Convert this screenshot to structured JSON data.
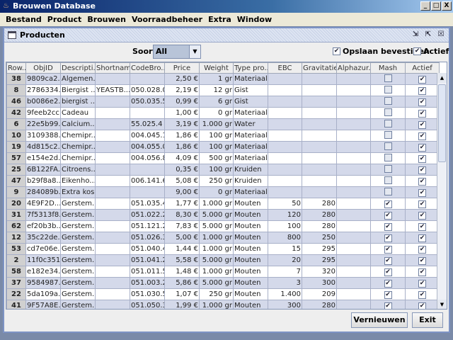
{
  "window": {
    "title": "Brouwen Database",
    "controls": [
      "_",
      "□",
      "X"
    ]
  },
  "menu": [
    "Bestand",
    "Product",
    "Brouwen",
    "Voorraadbeheer",
    "Extra",
    "Window"
  ],
  "frame": {
    "title": "Producten",
    "controls": [
      "⇲",
      "⇱",
      "☒"
    ]
  },
  "toolbar": {
    "soort_label": "Soort",
    "soort_value": "All",
    "opslaan_label": "Opslaan bevestigen",
    "opslaan_checked": true,
    "actief_label": "Actief",
    "actief_checked": true
  },
  "table": {
    "columns": [
      "Row...",
      "ObjID",
      "Descripti...",
      "Shortname",
      "CodeBro...",
      "Price",
      "Weight",
      "Type pro...",
      "EBC",
      "Gravitatie...",
      "Alphazur...",
      "Mash",
      "Actief"
    ],
    "rows": [
      [
        "38",
        "9809ca2...",
        "Algemen...",
        "",
        "",
        "2,50 €",
        "1 gr",
        "Materiaal",
        "",
        "",
        "",
        false,
        true
      ],
      [
        "8",
        "2786334...",
        "Biergist ...",
        "YEASTB...",
        "050.028.0",
        "2,19 €",
        "12 gr",
        "Gist",
        "",
        "",
        "",
        false,
        true
      ],
      [
        "46",
        "b0086e2...",
        "biergist ...",
        "",
        "050.035.5",
        "0,99 €",
        "6 gr",
        "Gist",
        "",
        "",
        "",
        false,
        true
      ],
      [
        "42",
        "9feeb2cc...",
        "Cadeau",
        "",
        "",
        "1,00 €",
        "0 gr",
        "Materiaal",
        "",
        "",
        "",
        false,
        true
      ],
      [
        "6",
        "22e5b99...",
        "Calcium...",
        "",
        "55.025.4",
        "3,19 €",
        "1.000 gr",
        "Water",
        "",
        "",
        "",
        false,
        true
      ],
      [
        "10",
        "3109388...",
        "Chemipr...",
        "",
        "004.045.1",
        "1,86 €",
        "100 gr",
        "Materiaal",
        "",
        "",
        "",
        false,
        true
      ],
      [
        "19",
        "4d815c2...",
        "Chemipr...",
        "",
        "004.055.0",
        "1,86 €",
        "100 gr",
        "Materiaal",
        "",
        "",
        "",
        false,
        true
      ],
      [
        "57",
        "e154e2d...",
        "Chemipr...",
        "",
        "004.056.8",
        "4,09 €",
        "500 gr",
        "Materiaal",
        "",
        "",
        "",
        false,
        true
      ],
      [
        "25",
        "6B122FA...",
        "Citroens...",
        "",
        "",
        "0,35 €",
        "100 gr",
        "Kruiden",
        "",
        "",
        "",
        false,
        true
      ],
      [
        "47",
        "b29f8a8...",
        "Eikenho...",
        "",
        "006.141.6",
        "5,08 €",
        "250 gr",
        "Kruiden",
        "",
        "",
        "",
        false,
        true
      ],
      [
        "9",
        "284089b...",
        "Extra kos...",
        "",
        "",
        "9,00 €",
        "0 gr",
        "Materiaal",
        "",
        "",
        "",
        false,
        true
      ],
      [
        "20",
        "4E9F2D...",
        "Gerstem...",
        "",
        "051.035.4",
        "1,77 €",
        "1.000 gr",
        "Mouten",
        "50",
        "280",
        "",
        true,
        true
      ],
      [
        "31",
        "7f5313f8...",
        "Gerstem...",
        "",
        "051.022.2",
        "8,30 €",
        "5.000 gr",
        "Mouten",
        "120",
        "280",
        "",
        true,
        true
      ],
      [
        "62",
        "ef20b3b...",
        "Gerstem...",
        "",
        "051.121.2",
        "7,83 €",
        "5.000 gr",
        "Mouten",
        "100",
        "280",
        "",
        true,
        true
      ],
      [
        "12",
        "35c22de...",
        "Gerstem...",
        "",
        "051.026.3",
        "5,00 €",
        "1.000 gr",
        "Mouten",
        "800",
        "250",
        "",
        true,
        true
      ],
      [
        "53",
        "cd7e06e...",
        "Gerstem...",
        "",
        "051.040.4",
        "1,44 €",
        "1.000 gr",
        "Mouten",
        "15",
        "295",
        "",
        true,
        true
      ],
      [
        "2",
        "11f0c351...",
        "Gerstem...",
        "",
        "051.041.2",
        "5,58 €",
        "5.000 gr",
        "Mouten",
        "20",
        "295",
        "",
        true,
        true
      ],
      [
        "58",
        "e182e34...",
        "Gerstem...",
        "",
        "051.011.5",
        "1,48 €",
        "1.000 gr",
        "Mouten",
        "7",
        "320",
        "",
        true,
        true
      ],
      [
        "37",
        "9584987...",
        "Gerstem...",
        "",
        "051.003.2",
        "5,86 €",
        "5.000 gr",
        "Mouten",
        "3",
        "300",
        "",
        true,
        true
      ],
      [
        "22",
        "5da109a...",
        "Gerstem...",
        "",
        "051.030.5",
        "1,07 €",
        "250 gr",
        "Mouten",
        "1.400",
        "209",
        "",
        true,
        true
      ],
      [
        "41",
        "9F57A8E...",
        "Gerstem...",
        "",
        "051.050.3",
        "1,99 €",
        "1.000 gr",
        "Mouten",
        "300",
        "280",
        "",
        true,
        true
      ]
    ]
  },
  "buttons": {
    "refresh": "Vernieuwen",
    "exit": "Exit"
  }
}
